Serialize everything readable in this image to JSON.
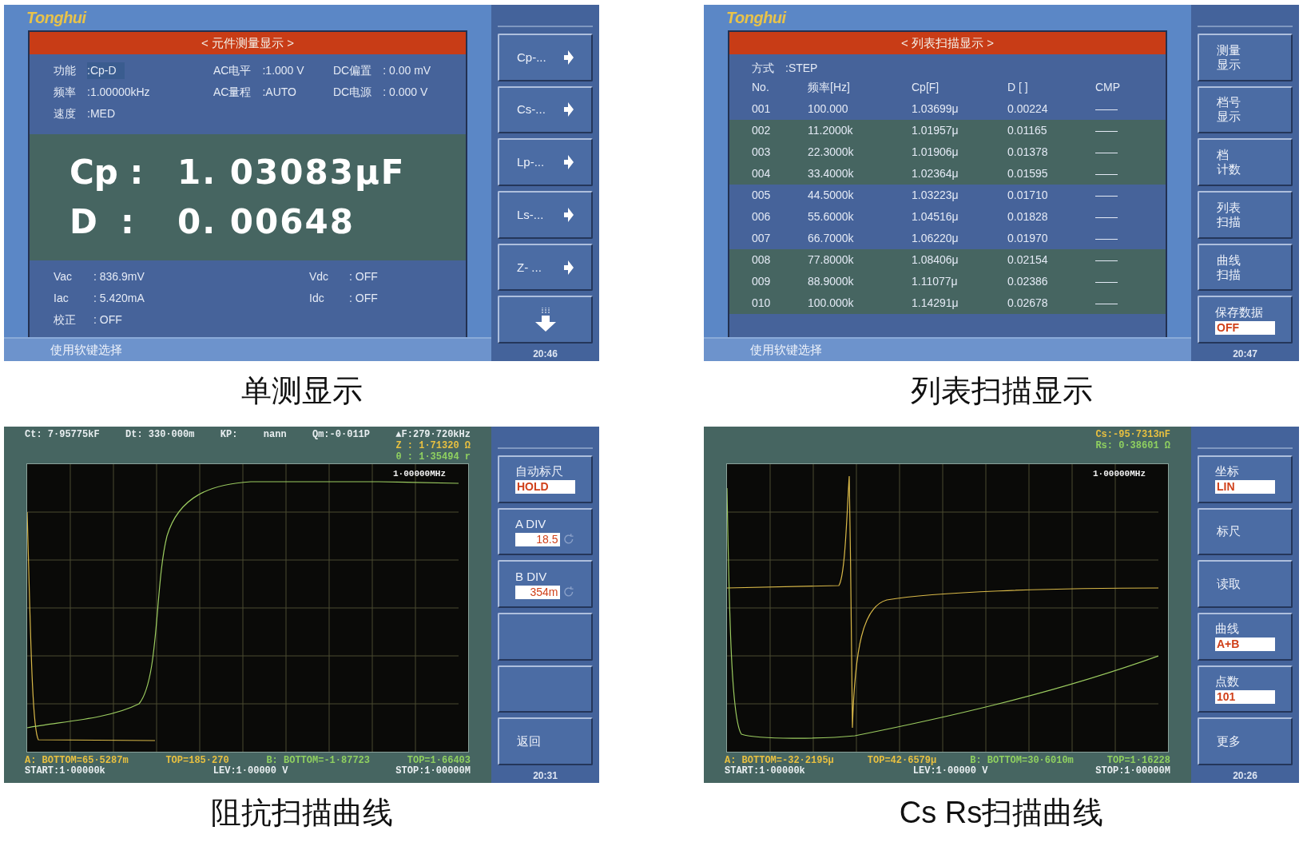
{
  "panels": [
    {
      "kind": "measure",
      "logo": "Tonghui",
      "title": "< 元件测量显示 >",
      "settings": [
        {
          "label": "功能",
          "value": ":Cp-D",
          "selected": true
        },
        {
          "label": "AC电平",
          "value": ":1.000 V",
          "selected": false
        },
        {
          "label": "DC偏置",
          "value": ": 0.00   mV",
          "selected": false
        },
        {
          "label": "频率",
          "value": ":1.00000kHz",
          "selected": false
        },
        {
          "label": "AC量程",
          "value": ":AUTO",
          "selected": false
        },
        {
          "label": "DC电源",
          "value": ": 0.000 V",
          "selected": false
        },
        {
          "label": "速度",
          "value": ":MED",
          "selected": false
        }
      ],
      "readings": [
        {
          "label": "Cp :",
          "value": "1. 03083μF"
        },
        {
          "label": "D  :",
          "value": "0. 00648"
        }
      ],
      "monitor": [
        {
          "label": "Vac",
          "value": ": 836.9mV"
        },
        {
          "label": "Vdc",
          "value": ": OFF"
        },
        {
          "label": "Iac",
          "value": ": 5.420mA"
        },
        {
          "label": "Idc",
          "value": ": OFF"
        },
        {
          "label": "校正",
          "value": ": OFF"
        }
      ],
      "status": "使用软键选择",
      "softkeys": [
        {
          "kind": "arrow",
          "lines": [
            "Cp-..."
          ]
        },
        {
          "kind": "arrow",
          "lines": [
            "Cs-..."
          ]
        },
        {
          "kind": "arrow",
          "lines": [
            "Lp-..."
          ]
        },
        {
          "kind": "arrow",
          "lines": [
            "Ls-..."
          ]
        },
        {
          "kind": "arrow",
          "lines": [
            "Z- ..."
          ]
        },
        {
          "kind": "down"
        }
      ],
      "time": "20:46",
      "caption": "单测显示"
    },
    {
      "kind": "list",
      "logo": "Tonghui",
      "title": "< 列表扫描显示 >",
      "mode": {
        "label": "方式",
        "value": ":STEP"
      },
      "columns": [
        "No.",
        "频率[Hz]",
        "Cp[F]",
        "D [ ]",
        "CMP"
      ],
      "rows": [
        {
          "color": "#46639a",
          "cells": [
            "001",
            "100.000",
            "1.03699μ",
            "0.00224",
            "——"
          ]
        },
        {
          "color": "#466561",
          "cells": [
            "002",
            "11.2000k",
            "1.01957μ",
            "0.01165",
            "——"
          ]
        },
        {
          "color": "#466561",
          "cells": [
            "003",
            "22.3000k",
            "1.01906μ",
            "0.01378",
            "——"
          ]
        },
        {
          "color": "#466561",
          "cells": [
            "004",
            "33.4000k",
            "1.02364μ",
            "0.01595",
            "——"
          ]
        },
        {
          "color": "#46639a",
          "cells": [
            "005",
            "44.5000k",
            "1.03223μ",
            "0.01710",
            "——"
          ]
        },
        {
          "color": "#46639a",
          "cells": [
            "006",
            "55.6000k",
            "1.04516μ",
            "0.01828",
            "——"
          ]
        },
        {
          "color": "#46639a",
          "cells": [
            "007",
            "66.7000k",
            "1.06220μ",
            "0.01970",
            "——"
          ]
        },
        {
          "color": "#466561",
          "cells": [
            "008",
            "77.8000k",
            "1.08406μ",
            "0.02154",
            "——"
          ]
        },
        {
          "color": "#466561",
          "cells": [
            "009",
            "88.9000k",
            "1.11077μ",
            "0.02386",
            "——"
          ]
        },
        {
          "color": "#466561",
          "cells": [
            "010",
            "100.000k",
            "1.14291μ",
            "0.02678",
            "——"
          ]
        }
      ],
      "status": "使用软键选择",
      "softkeys": [
        {
          "kind": "text",
          "lines": [
            "测量",
            "显示"
          ]
        },
        {
          "kind": "text",
          "lines": [
            "档号",
            "显示"
          ]
        },
        {
          "kind": "text",
          "lines": [
            "档",
            "计数"
          ]
        },
        {
          "kind": "text",
          "lines": [
            "列表",
            "扫描"
          ]
        },
        {
          "kind": "text",
          "lines": [
            "曲线",
            "扫描"
          ]
        },
        {
          "kind": "field",
          "lines": [
            "保存数据"
          ],
          "value": "OFF"
        }
      ],
      "time": "20:47",
      "caption": "列表扫描显示"
    },
    {
      "kind": "sweep",
      "curve": {
        "kind": "impedance"
      },
      "readout_rows": [
        [
          {
            "text": "Ct: 7·95775kF",
            "color": "#e8eef0"
          },
          {
            "text": "Dt: 330·000m",
            "color": "#e8eef0"
          },
          {
            "text": "KP:",
            "color": "#e8eef0"
          },
          {
            "text": "nann",
            "color": "#e8eef0"
          },
          {
            "text": "Qm:-0·011P",
            "color": "#e8eef0"
          },
          {
            "text": "▲F:279·720kHz",
            "color": "#e8eef0"
          }
        ],
        [
          {
            "text": "Z : 1·71320 Ω",
            "color": "#e8c040"
          }
        ],
        [
          {
            "text": "θ : 1·35494 r",
            "color": "#8fd060"
          }
        ]
      ],
      "marker": "1·00000MHz",
      "footer_rows": [
        [
          {
            "text": "A: BOTTOM=65·5287m",
            "color": "#e8c040"
          },
          {
            "text": "TOP=185·270",
            "color": "#e8c040"
          },
          {
            "text": "B: BOTTOM=-1·87723",
            "color": "#8fd060"
          },
          {
            "text": "TOP=1·66403",
            "color": "#8fd060"
          }
        ],
        [
          {
            "text": "START:1·00000k",
            "color": "#e8eef0"
          },
          {
            "text": "LEV:1·00000 V",
            "color": "#e8eef0"
          },
          {
            "text": "STOP:1·00000M",
            "color": "#e8eef0"
          }
        ]
      ],
      "softkeys": [
        {
          "kind": "field",
          "lines": [
            "自动标尺"
          ],
          "value": "HOLD"
        },
        {
          "kind": "knob",
          "lines": [
            "A DIV"
          ],
          "value": "18.5"
        },
        {
          "kind": "knob",
          "lines": [
            "B DIV"
          ],
          "value": "354m"
        },
        {
          "kind": "blank"
        },
        {
          "kind": "blank"
        },
        {
          "kind": "text",
          "lines": [
            "返回"
          ]
        }
      ],
      "time": "20:31",
      "caption": "阻抗扫描曲线"
    },
    {
      "kind": "sweep",
      "curve": {
        "kind": "resonance"
      },
      "readout_rows": [
        [
          {
            "text": "Cs:-95·7313nF",
            "color": "#e8c040"
          }
        ],
        [
          {
            "text": "Rs: 0·38601 Ω",
            "color": "#8fd060"
          }
        ]
      ],
      "marker": "1·00000MHz",
      "footer_rows": [
        [
          {
            "text": "A: BOTTOM=-32·2195μ",
            "color": "#e8c040"
          },
          {
            "text": "TOP=42·6579μ",
            "color": "#e8c040"
          },
          {
            "text": "B: BOTTOM=30·6010m",
            "color": "#8fd060"
          },
          {
            "text": "TOP=1·16228",
            "color": "#8fd060"
          }
        ],
        [
          {
            "text": "START:1·00000k",
            "color": "#e8eef0"
          },
          {
            "text": "LEV:1·00000 V",
            "color": "#e8eef0"
          },
          {
            "text": "STOP:1·00000M",
            "color": "#e8eef0"
          }
        ]
      ],
      "softkeys": [
        {
          "kind": "field",
          "lines": [
            "坐标"
          ],
          "value": "LIN"
        },
        {
          "kind": "text",
          "lines": [
            "标尺"
          ]
        },
        {
          "kind": "text",
          "lines": [
            "读取"
          ]
        },
        {
          "kind": "field",
          "lines": [
            "曲线"
          ],
          "value": "A+B"
        },
        {
          "kind": "field",
          "lines": [
            "点数"
          ],
          "value": "101"
        },
        {
          "kind": "text",
          "lines": [
            "更多"
          ]
        }
      ],
      "time": "20:26",
      "caption": "Cs Rs扫描曲线"
    }
  ]
}
